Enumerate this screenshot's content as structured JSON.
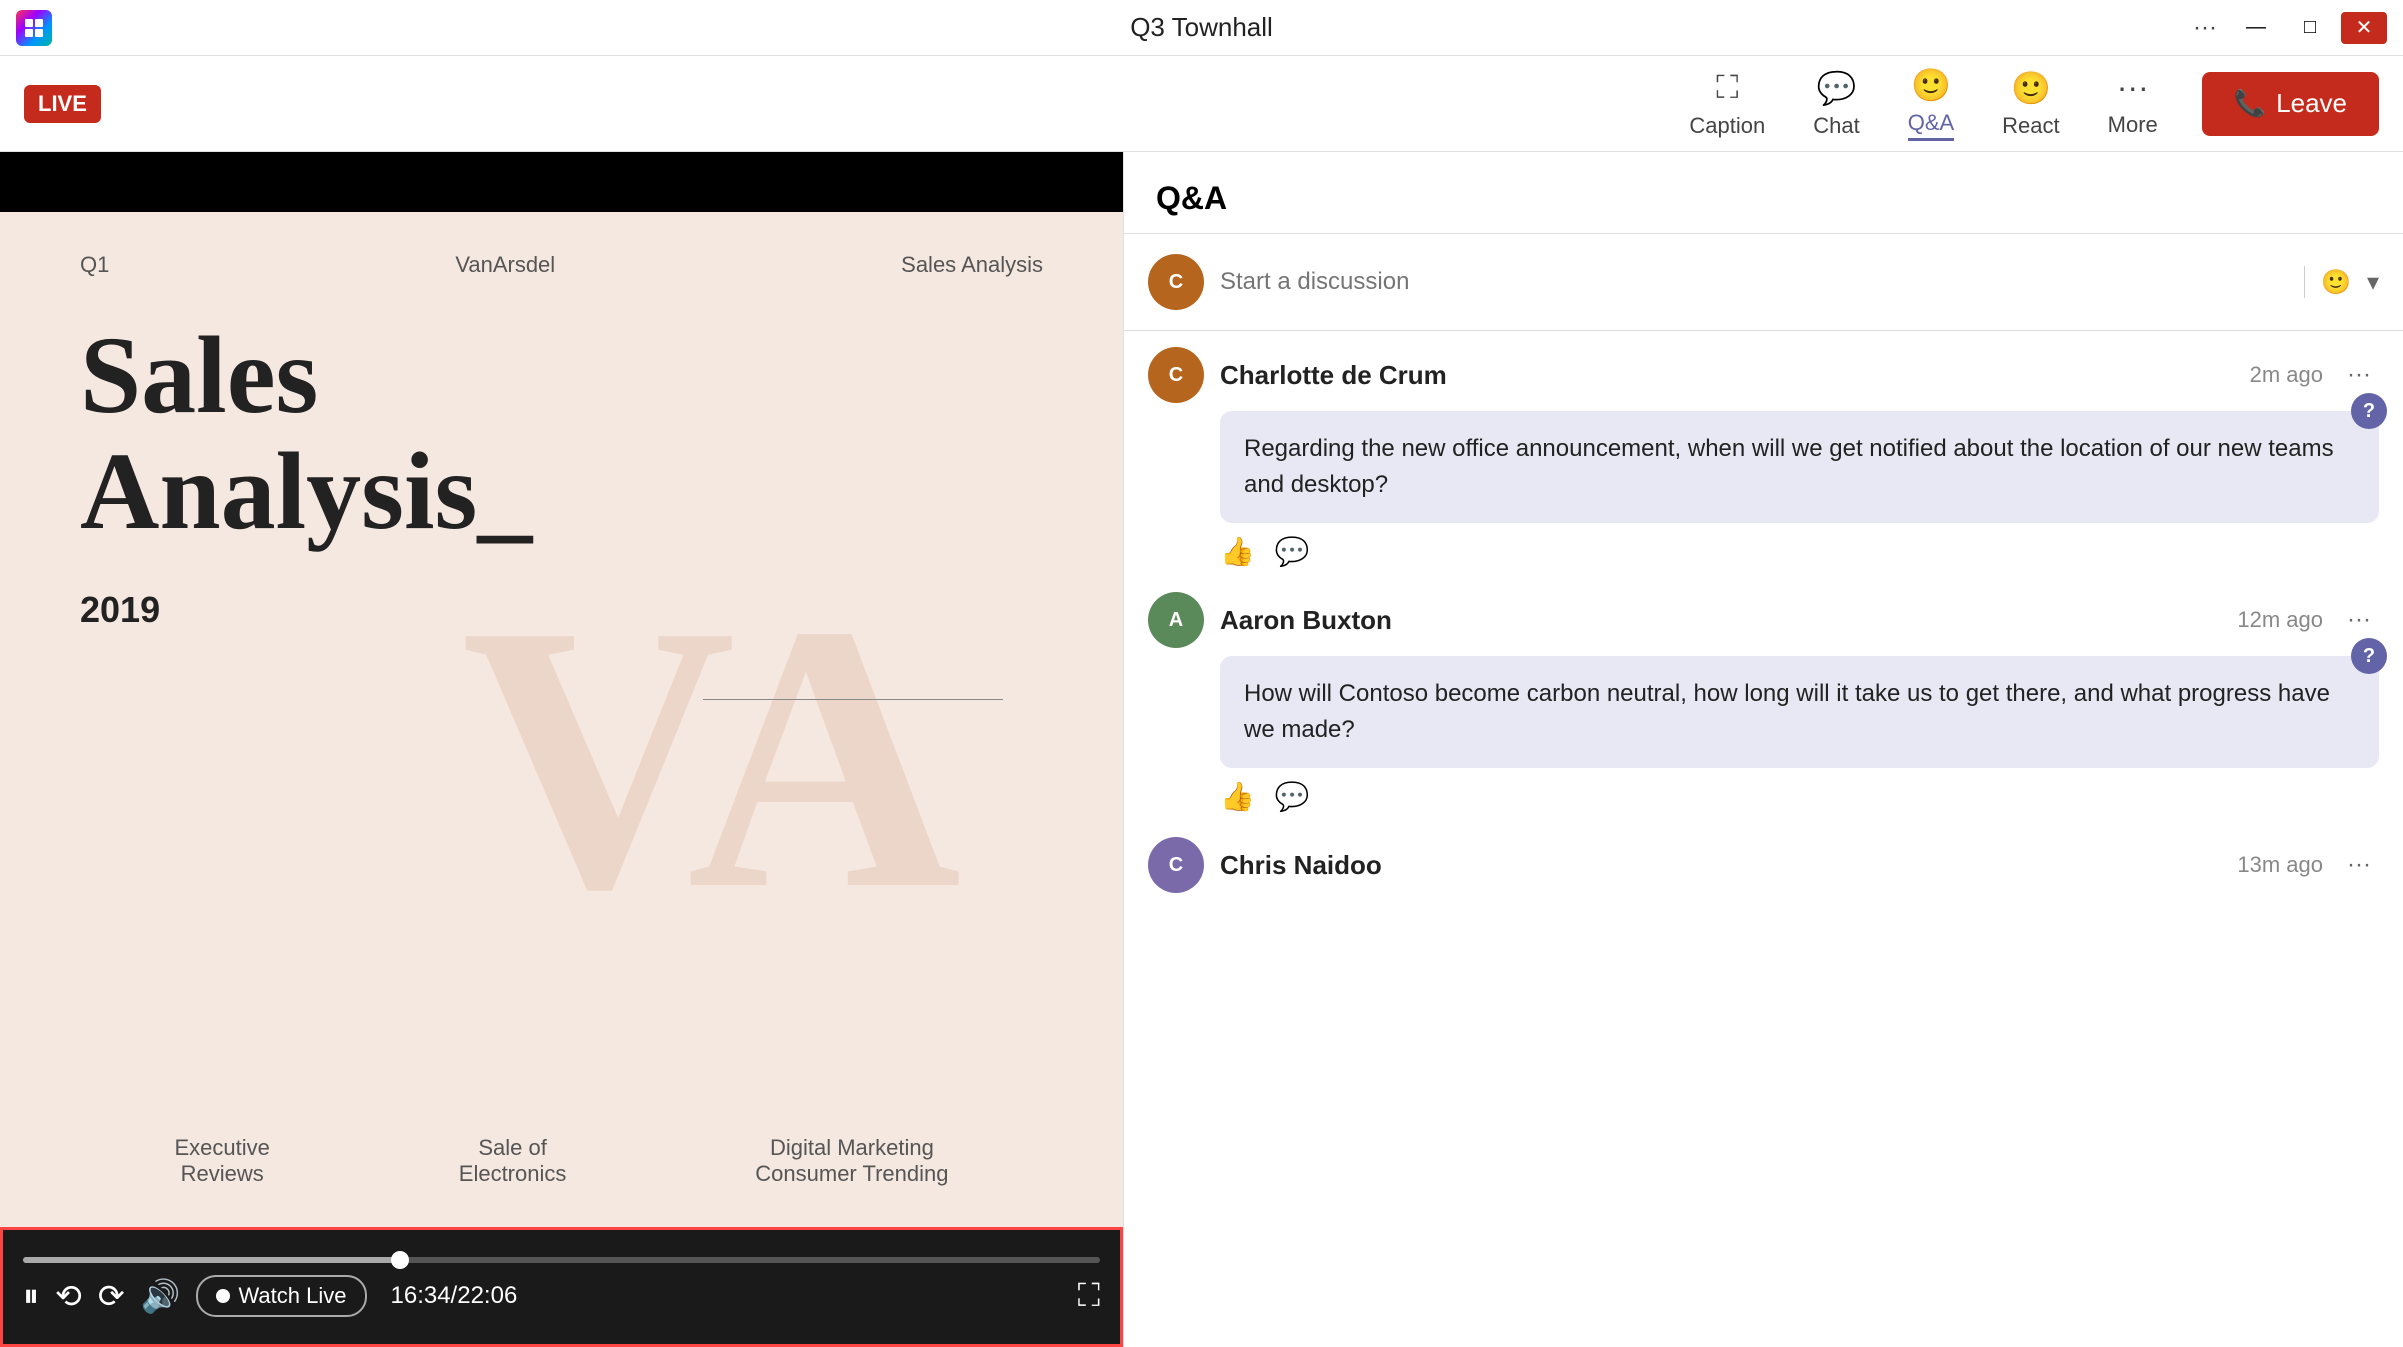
{
  "titlebar": {
    "title": "Q3 Townhall",
    "minimize": "—",
    "maximize": "□",
    "close": "✕"
  },
  "toolbar": {
    "live_badge": "LIVE",
    "caption_label": "Caption",
    "chat_label": "Chat",
    "qa_label": "Q&A",
    "react_label": "React",
    "more_label": "More",
    "leave_label": "Leave"
  },
  "slide": {
    "col1": "Q1",
    "col2": "VanArsdel",
    "col3": "Sales Analysis",
    "title_line1": "Sales",
    "title_line2": "Analysis_",
    "year": "2019",
    "watermark": "VA",
    "footer": [
      {
        "line1": "Executive",
        "line2": "Reviews"
      },
      {
        "line1": "Sale of",
        "line2": "Electronics"
      },
      {
        "line1": "Digital Marketing",
        "line2": "Consumer Trending"
      }
    ]
  },
  "controls": {
    "watch_live": "Watch Live",
    "time_current": "16:34",
    "time_total": "22:06",
    "time_display": "16:34/22:06",
    "progress_percent": 35
  },
  "qa": {
    "title": "Q&A",
    "input_placeholder": "Start a discussion",
    "messages": [
      {
        "id": 1,
        "name": "Charlotte de Crum",
        "time": "2m ago",
        "avatar_initials": "C",
        "avatar_class": "avatar-charlotte",
        "text": "Regarding the new office announcement, when will we get notified about the location of our new teams and desktop?"
      },
      {
        "id": 2,
        "name": "Aaron Buxton",
        "time": "12m ago",
        "avatar_initials": "A",
        "avatar_class": "avatar-aaron",
        "text": "How will Contoso become carbon neutral, how long will it take us to get there, and what progress have we made?"
      },
      {
        "id": 3,
        "name": "Chris Naidoo",
        "time": "13m ago",
        "avatar_initials": "C",
        "avatar_class": "avatar-chris",
        "text": ""
      }
    ]
  }
}
